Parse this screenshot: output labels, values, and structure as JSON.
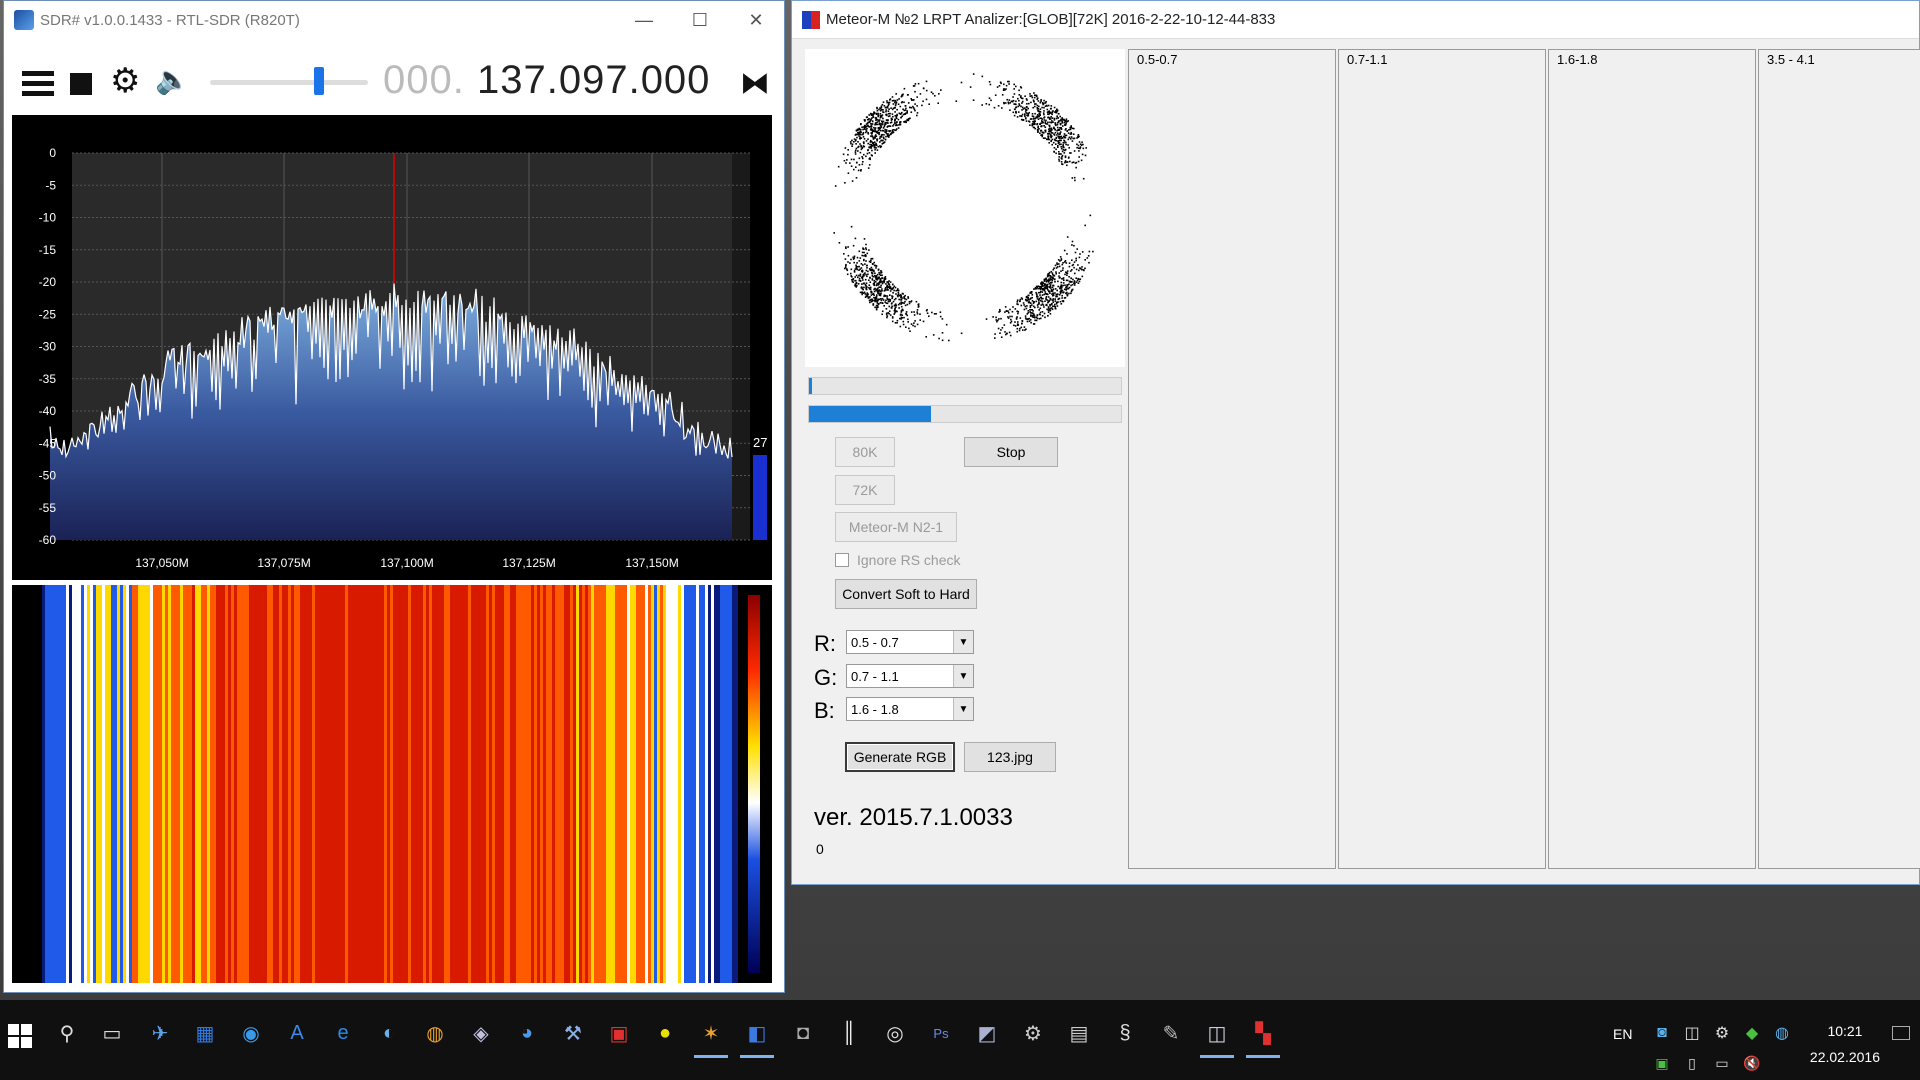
{
  "sdr": {
    "title": "SDR# v1.0.0.1433 - RTL-SDR (R820T)",
    "win_minimize": "—",
    "win_maximize": "☐",
    "win_close": "✕",
    "freq_dim": "000.",
    "freq_main": "137.097.000",
    "volume_level": 0.7,
    "spectrum": {
      "y_ticks": [
        "0",
        "-5",
        "-10",
        "-15",
        "-20",
        "-25",
        "-30",
        "-35",
        "-40",
        "-45",
        "-50",
        "-55",
        "-60"
      ],
      "x_ticks": [
        "137,050M",
        "137,075M",
        "137,100M",
        "137,125M",
        "137,150M"
      ],
      "side_level": "27",
      "colors": {
        "grid": "#555555",
        "trace": "#ffffff",
        "center": "#dd0000"
      }
    }
  },
  "meteor": {
    "title": "Meteor-M №2 LRPT Analizer:[GLOB][72K] 2016-2-22-10-12-44-833",
    "progress1": 0.01,
    "progress2": 0.39,
    "buttons": {
      "b80k": "80K",
      "b72k": "72K",
      "stop": "Stop",
      "meteor": "Meteor-M N2-1",
      "convert": "Convert Soft to Hard",
      "generate": "Generate RGB",
      "jpg": "123.jpg"
    },
    "ignore_rs": "Ignore RS check",
    "channels": {
      "r_label": "R:",
      "r_value": "0.5 - 0.7",
      "g_label": "G:",
      "g_value": "0.7 - 1.1",
      "b_label": "B:",
      "b_value": "1.6 - 1.8"
    },
    "version": "ver. 2015.7.1.0033",
    "counter": "0",
    "bands": [
      "0.5-0.7",
      "0.7-1.1",
      "1.6-1.8",
      "3.5 - 4.1"
    ]
  },
  "taskbar": {
    "lang": "EN",
    "time": "10:21",
    "date": "22.02.2016"
  }
}
